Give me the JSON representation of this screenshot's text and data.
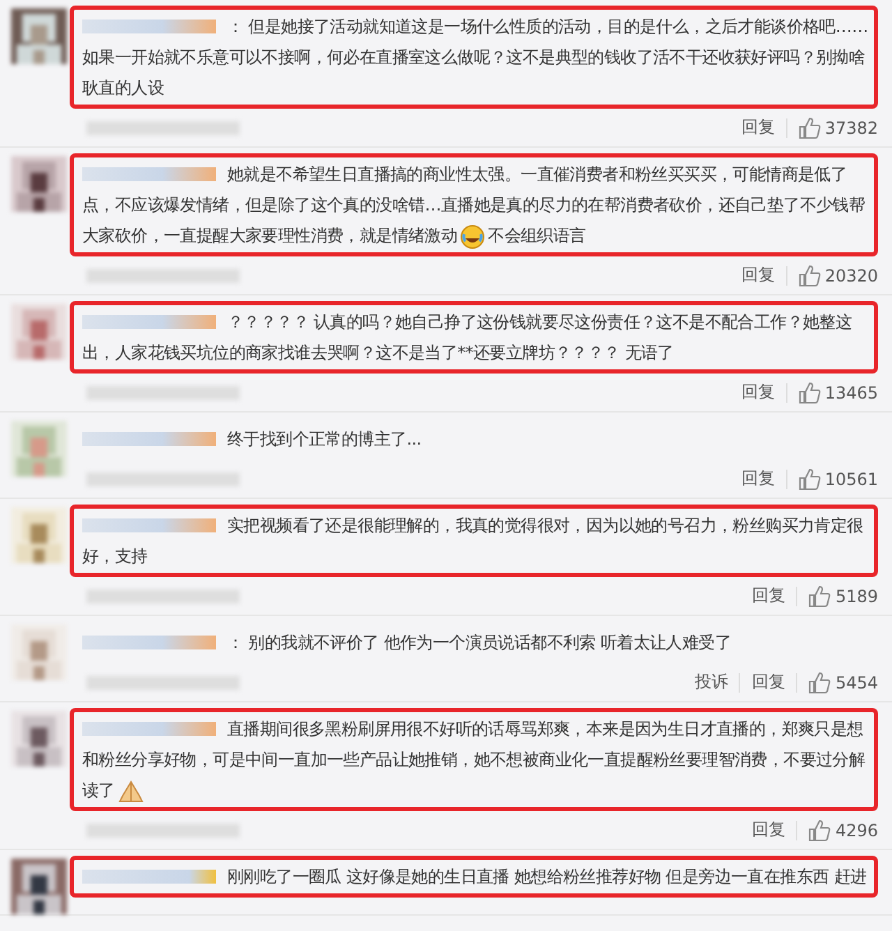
{
  "comments": [
    {
      "highlighted": true,
      "segments": [
        {
          "kind": "text",
          "text": "： 但是她接了活动就知道这是一场什么性质的活动，目的是什么，之后才能谈价格吧……如果一开始就不乐意可以不接啊，何必在直播室这么做呢？这不是典型的钱收了活不干还收获好评吗？别拗啥耿直的人设"
        }
      ],
      "actions": [
        "回复"
      ],
      "likes": "37382"
    },
    {
      "highlighted": true,
      "segments": [
        {
          "kind": "text",
          "text": "她就是不希望生日直播搞的商业性太强。一直催消费者和粉丝买买买，可能情商是低了点，不应该爆发情绪，但是除了这个真的没啥错…直播她是真的尽力的在帮消费者砍价，还自己垫了不少钱帮大家砍价，一直提醒大家要理性消费，就是情绪激动"
        },
        {
          "kind": "emoji"
        },
        {
          "kind": "text",
          "text": "不会组织语言"
        }
      ],
      "actions": [
        "回复"
      ],
      "likes": "20320"
    },
    {
      "highlighted": true,
      "segments": [
        {
          "kind": "text",
          "text": "？？？？？ 认真的吗？她自己挣了这份钱就要尽这份责任？这不是不配合工作？她整这出，人家花钱买坑位的商家找谁去哭啊？这不是当了**还要立牌坊？？？？ 无语了"
        }
      ],
      "actions": [
        "回复"
      ],
      "likes": "13465"
    },
    {
      "highlighted": false,
      "segments": [
        {
          "kind": "text",
          "text": "终于找到个正常的博主了..."
        }
      ],
      "actions": [
        "回复"
      ],
      "likes": "10561"
    },
    {
      "highlighted": true,
      "segments": [
        {
          "kind": "text",
          "text": "实把视频看了还是很能理解的，我真的觉得很对，因为以她的号召力，粉丝购买力肯定很好，支持"
        }
      ],
      "actions": [
        "回复"
      ],
      "likes": "5189"
    },
    {
      "highlighted": false,
      "segments": [
        {
          "kind": "text",
          "text": "： 别的我就不评价了 他作为一个演员说话都不利索 听着太让人难受了"
        }
      ],
      "actions": [
        "投诉",
        "回复"
      ],
      "likes": "5454"
    },
    {
      "highlighted": true,
      "segments": [
        {
          "kind": "text",
          "text": "直播期间很多黑粉刷屏用很不好听的话辱骂郑爽，本来是因为生日才直播的，郑爽只是想和粉丝分享好物，可是中间一直加一些产品让她推销，她不想被商业化一直提醒粉丝要理智消费，不要过分解读了"
        },
        {
          "kind": "hands"
        }
      ],
      "actions": [
        "回复"
      ],
      "likes": "4296"
    },
    {
      "highlighted": true,
      "segments": [
        {
          "kind": "text",
          "text": "刚刚吃了一圈瓜 这好像是她的生日直播 她想给粉丝推荐好物 但是旁边一直在推东西 赶进"
        }
      ]
    }
  ]
}
